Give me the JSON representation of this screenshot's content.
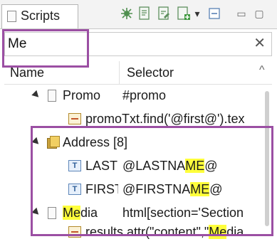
{
  "panel": {
    "tab_title": "Scripts",
    "toolbar": {
      "icons": [
        "bug-icon",
        "new-page-icon",
        "edit-page-icon",
        "add-page-icon",
        "dropdown-arrow-icon",
        "collapse-icon",
        "minimize-icon",
        "maximize-icon"
      ],
      "dropdown_glyph": "▾",
      "minimize_glyph": "▭",
      "maximize_glyph": "▢"
    }
  },
  "search": {
    "value": "Me",
    "clear_glyph": "✕"
  },
  "table": {
    "columns": [
      "Name",
      "Selector"
    ],
    "sort_glyph": "^",
    "rows": [
      {
        "name": "Promo",
        "selector": "#promo"
      },
      {
        "name": "promoTxt.find('@first@').tex",
        "selector": ""
      },
      {
        "name": "Address [8]",
        "selector": ""
      },
      {
        "name": "LASTI",
        "selector_parts": [
          "@LASTNA",
          "ME",
          "@"
        ]
      },
      {
        "name": "FIRST",
        "selector_parts": [
          "@FIRSTNA",
          "ME",
          "@"
        ]
      },
      {
        "name_parts": [
          "Me",
          "dia"
        ],
        "selector": "html[section='Section"
      },
      {
        "name_parts": [
          "results.attr(\"content\",\"",
          "Me",
          "dia"
        ]
      }
    ]
  },
  "colors": {
    "highlight": "#ffff3b",
    "annotation_box": "#9b4fa3"
  }
}
